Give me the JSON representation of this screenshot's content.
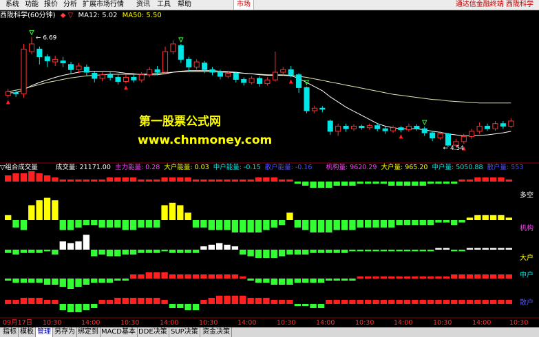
{
  "menu": [
    "系统",
    "功能",
    "报价",
    "分析",
    "扩展市场行情",
    "资讯",
    "工具",
    "帮助"
  ],
  "market_tab": "市场",
  "broker_title": "通达信金融终端  西陇科学",
  "info": {
    "stock": "西陇科学(60分钟)",
    "arrows": "◆ ▽",
    "ma12": "MA12: 5.02",
    "ma50": "MA50: 5.50"
  },
  "price_labels": {
    "high": "6.69",
    "low": "4.54"
  },
  "watermark": {
    "line1": "第一股票公式网",
    "line2": "www.chnmoney.com"
  },
  "sub": {
    "title": "▽组合成交量",
    "vol": "成交量: 21171.00",
    "main": "主力能量: 0.28",
    "big": "大户能量: 0.03",
    "mid": "中户能量: -0.15",
    "small": "散户能量: -0.16",
    "inst": "机构量: 9620.29",
    "bigvol": "大户量: 965.20",
    "midvol": "中户量: 5050.88",
    "smallvol": "散户量: 553"
  },
  "side_labels": [
    "多空",
    "机构",
    "大户",
    "中户",
    "散户"
  ],
  "time_axis": [
    "09月17日",
    "10:30",
    "14:00",
    "10:30",
    "14:00",
    "10:30",
    "14:00",
    "10:30",
    "14:00",
    "10:30",
    "14:00",
    "10:30",
    "14:00",
    "10:30"
  ],
  "tabs": [
    "指标",
    "模板",
    "管理",
    "另存为",
    "绑定到",
    "MACD基本",
    "DDE决策",
    "SUP决策",
    "资金决策"
  ],
  "active_tab": "管理",
  "colors": {
    "up": "#ff3232",
    "down": "#00e6e6",
    "ma12": "#ffffff",
    "ma50": "#e6e6b4",
    "green": "#32ff32",
    "red": "#ff2020",
    "yellow": "#ffff00",
    "white": "#ffffff",
    "gridline": "#8b0000"
  },
  "chart_data": {
    "type": "candlestick",
    "title": "西陇科学(60分钟)",
    "ylim": [
      4.3,
      6.95
    ],
    "candles": [
      {
        "o": 5.55,
        "c": 5.62,
        "h": 5.68,
        "l": 5.5
      },
      {
        "o": 5.6,
        "c": 5.58,
        "h": 5.66,
        "l": 5.52
      },
      {
        "o": 5.58,
        "c": 6.45,
        "h": 6.55,
        "l": 5.5
      },
      {
        "o": 6.4,
        "c": 6.55,
        "h": 6.69,
        "l": 6.35
      },
      {
        "o": 6.45,
        "c": 6.3,
        "h": 6.5,
        "l": 6.15
      },
      {
        "o": 6.3,
        "c": 6.22,
        "h": 6.35,
        "l": 6.1
      },
      {
        "o": 6.2,
        "c": 6.25,
        "h": 6.32,
        "l": 6.12
      },
      {
        "o": 6.22,
        "c": 6.18,
        "h": 6.3,
        "l": 6.1
      },
      {
        "o": 6.15,
        "c": 6.05,
        "h": 6.2,
        "l": 5.98
      },
      {
        "o": 6.05,
        "c": 6.12,
        "h": 6.18,
        "l": 5.98
      },
      {
        "o": 6.1,
        "c": 6.0,
        "h": 6.15,
        "l": 5.92
      },
      {
        "o": 5.98,
        "c": 5.88,
        "h": 6.02,
        "l": 5.8
      },
      {
        "o": 5.88,
        "c": 5.95,
        "h": 6.0,
        "l": 5.82
      },
      {
        "o": 5.95,
        "c": 5.9,
        "h": 6.0,
        "l": 5.84
      },
      {
        "o": 5.9,
        "c": 5.82,
        "h": 5.95,
        "l": 5.76
      },
      {
        "o": 5.82,
        "c": 5.9,
        "h": 5.96,
        "l": 5.78
      },
      {
        "o": 5.9,
        "c": 5.85,
        "h": 5.95,
        "l": 5.8
      },
      {
        "o": 5.85,
        "c": 5.95,
        "h": 6.0,
        "l": 5.8
      },
      {
        "o": 5.95,
        "c": 6.05,
        "h": 6.1,
        "l": 5.9
      },
      {
        "o": 6.05,
        "c": 6.0,
        "h": 6.12,
        "l": 5.95
      },
      {
        "o": 6.0,
        "c": 6.4,
        "h": 6.5,
        "l": 5.98
      },
      {
        "o": 6.4,
        "c": 6.55,
        "h": 6.62,
        "l": 6.35
      },
      {
        "o": 6.52,
        "c": 6.25,
        "h": 6.55,
        "l": 6.18
      },
      {
        "o": 6.25,
        "c": 6.1,
        "h": 6.3,
        "l": 6.02
      },
      {
        "o": 6.1,
        "c": 6.2,
        "h": 6.25,
        "l": 6.05
      },
      {
        "o": 6.18,
        "c": 6.05,
        "h": 6.22,
        "l": 5.98
      },
      {
        "o": 6.05,
        "c": 6.0,
        "h": 6.1,
        "l": 5.94
      },
      {
        "o": 6.0,
        "c": 5.92,
        "h": 6.05,
        "l": 5.86
      },
      {
        "o": 5.92,
        "c": 5.98,
        "h": 6.03,
        "l": 5.88
      },
      {
        "o": 5.98,
        "c": 5.86,
        "h": 6.0,
        "l": 5.8
      },
      {
        "o": 5.86,
        "c": 5.8,
        "h": 5.9,
        "l": 5.74
      },
      {
        "o": 5.8,
        "c": 5.88,
        "h": 5.92,
        "l": 5.76
      },
      {
        "o": 5.88,
        "c": 5.78,
        "h": 5.92,
        "l": 5.72
      },
      {
        "o": 5.78,
        "c": 5.85,
        "h": 5.9,
        "l": 5.74
      },
      {
        "o": 5.85,
        "c": 6.0,
        "h": 6.4,
        "l": 5.82
      },
      {
        "o": 6.0,
        "c": 6.05,
        "h": 6.1,
        "l": 5.94
      },
      {
        "o": 6.05,
        "c": 5.95,
        "h": 6.12,
        "l": 5.9
      },
      {
        "o": 5.95,
        "c": 5.7,
        "h": 5.98,
        "l": 5.6
      },
      {
        "o": 5.7,
        "c": 5.25,
        "h": 5.72,
        "l": 5.2
      },
      {
        "o": 5.25,
        "c": 5.3,
        "h": 5.35,
        "l": 5.2
      },
      {
        "o": 5.3,
        "c": 5.28,
        "h": 5.34,
        "l": 5.22
      },
      {
        "o": 5.05,
        "c": 4.85,
        "h": 5.08,
        "l": 4.78
      },
      {
        "o": 4.85,
        "c": 4.95,
        "h": 5.0,
        "l": 4.76
      },
      {
        "o": 4.95,
        "c": 4.9,
        "h": 5.0,
        "l": 4.84
      },
      {
        "o": 4.9,
        "c": 4.95,
        "h": 4.99,
        "l": 4.86
      },
      {
        "o": 4.95,
        "c": 4.92,
        "h": 4.98,
        "l": 4.88
      },
      {
        "o": 4.92,
        "c": 4.96,
        "h": 5.0,
        "l": 4.88
      },
      {
        "o": 4.96,
        "c": 4.9,
        "h": 5.0,
        "l": 4.85
      },
      {
        "o": 4.9,
        "c": 4.86,
        "h": 4.94,
        "l": 4.8
      },
      {
        "o": 4.86,
        "c": 4.92,
        "h": 4.96,
        "l": 4.82
      },
      {
        "o": 4.92,
        "c": 4.88,
        "h": 4.95,
        "l": 4.83
      },
      {
        "o": 4.88,
        "c": 4.95,
        "h": 5.0,
        "l": 4.84
      },
      {
        "o": 4.95,
        "c": 4.9,
        "h": 4.99,
        "l": 4.86
      },
      {
        "o": 4.9,
        "c": 4.82,
        "h": 4.94,
        "l": 4.76
      },
      {
        "o": 4.82,
        "c": 4.72,
        "h": 4.86,
        "l": 4.66
      },
      {
        "o": 4.72,
        "c": 4.8,
        "h": 4.85,
        "l": 4.68
      },
      {
        "o": 4.8,
        "c": 4.58,
        "h": 4.82,
        "l": 4.54
      },
      {
        "o": 4.58,
        "c": 4.65,
        "h": 4.7,
        "l": 4.54
      },
      {
        "o": 4.65,
        "c": 4.75,
        "h": 4.8,
        "l": 4.6
      },
      {
        "o": 4.75,
        "c": 4.85,
        "h": 4.9,
        "l": 4.7
      },
      {
        "o": 4.85,
        "c": 4.95,
        "h": 5.02,
        "l": 4.8
      },
      {
        "o": 4.95,
        "c": 4.9,
        "h": 5.0,
        "l": 4.86
      },
      {
        "o": 4.9,
        "c": 5.0,
        "h": 5.05,
        "l": 4.86
      },
      {
        "o": 5.0,
        "c": 4.95,
        "h": 5.05,
        "l": 4.9
      },
      {
        "o": 4.95,
        "c": 5.05,
        "h": 5.1,
        "l": 4.92
      }
    ],
    "ma12": [
      5.6,
      5.6,
      5.66,
      5.74,
      5.8,
      5.85,
      5.9,
      5.94,
      5.97,
      6.0,
      6.02,
      6.02,
      6.02,
      6.02,
      6.0,
      5.98,
      5.97,
      5.95,
      5.95,
      5.95,
      5.97,
      6.0,
      6.02,
      6.03,
      6.03,
      6.03,
      6.03,
      6.02,
      6.01,
      6.0,
      5.98,
      5.97,
      5.95,
      5.94,
      5.94,
      5.94,
      5.93,
      5.88,
      5.8,
      5.72,
      5.64,
      5.52,
      5.42,
      5.32,
      5.24,
      5.16,
      5.08,
      5.0,
      4.95,
      4.92,
      4.9,
      4.9,
      4.9,
      4.88,
      4.85,
      4.83,
      4.8,
      4.78,
      4.76,
      4.76,
      4.77,
      4.78,
      4.8,
      4.82,
      4.85
    ],
    "ma50": [
      5.62,
      5.65,
      5.68,
      5.72,
      5.76,
      5.8,
      5.83,
      5.86,
      5.89,
      5.91,
      5.93,
      5.94,
      5.95,
      5.96,
      5.96,
      5.96,
      5.96,
      5.96,
      5.97,
      5.98,
      5.99,
      6.0,
      6.01,
      6.01,
      6.01,
      6.01,
      6.01,
      6.0,
      6.0,
      5.99,
      5.98,
      5.97,
      5.96,
      5.95,
      5.95,
      5.95,
      5.94,
      5.92,
      5.9,
      5.87,
      5.84,
      5.81,
      5.78,
      5.75,
      5.72,
      5.69,
      5.66,
      5.63,
      5.6,
      5.57,
      5.55,
      5.53,
      5.51,
      5.49,
      5.47,
      5.46,
      5.44,
      5.43,
      5.42,
      5.41,
      5.4,
      5.4,
      5.4,
      5.4,
      5.4
    ],
    "markers": [
      {
        "i": 0,
        "kind": "buy"
      },
      {
        "i": 3,
        "kind": "sell"
      },
      {
        "i": 15,
        "kind": "buy"
      },
      {
        "i": 22,
        "kind": "sell"
      },
      {
        "i": 36,
        "kind": "buy"
      },
      {
        "i": 38,
        "kind": "sell"
      },
      {
        "i": 50,
        "kind": "buy"
      },
      {
        "i": 53,
        "kind": "sell"
      },
      {
        "i": 58,
        "kind": "buy"
      }
    ],
    "bands": {
      "duokong": [
        3,
        4,
        4,
        5,
        4,
        3,
        2,
        1,
        1,
        1,
        1,
        1,
        1,
        2,
        2,
        2,
        2,
        1,
        1,
        1,
        2,
        2,
        2,
        2,
        1,
        1,
        1,
        1,
        1,
        1,
        1,
        1,
        2,
        2,
        2,
        1,
        1,
        -1,
        -2,
        -3,
        -3,
        -3,
        -2,
        -2,
        -2,
        -1,
        -1,
        -1,
        -1,
        -2,
        -2,
        -2,
        -2,
        -2,
        -1,
        -1,
        -1,
        -1,
        1,
        1,
        2,
        2,
        2,
        2,
        1
      ],
      "jigou": [
        2,
        -3,
        -4,
        6,
        8,
        9,
        8,
        -4,
        -4,
        -3,
        -2,
        -2,
        -3,
        -3,
        -3,
        -4,
        -4,
        -3,
        -3,
        -3,
        6,
        7,
        6,
        3,
        -3,
        -3,
        -4,
        -4,
        -4,
        -5,
        -5,
        -5,
        -5,
        -4,
        -3,
        -2,
        3,
        -3,
        -4,
        -5,
        -5,
        -5,
        -4,
        -4,
        -4,
        -3,
        -3,
        -3,
        -3,
        -3,
        -2,
        -2,
        -2,
        -2,
        -2,
        -1,
        -1,
        -2,
        -1,
        1,
        2,
        2,
        2,
        2,
        1
      ],
      "dahu": [
        -2,
        -3,
        -2,
        -2,
        -2,
        -1,
        -3,
        5,
        4,
        5,
        9,
        -4,
        -3,
        -4,
        -4,
        -3,
        -3,
        -2,
        -2,
        -2,
        -1,
        -2,
        -2,
        -2,
        -2,
        2,
        3,
        4,
        3,
        2,
        -3,
        -4,
        -5,
        -5,
        -5,
        -4,
        -3,
        -3,
        -3,
        -2,
        -2,
        -2,
        -2,
        -2,
        -1,
        -1,
        -1,
        -1,
        -1,
        -1,
        -1,
        -1,
        -1,
        -1,
        -1,
        1,
        1,
        -1,
        -1,
        1,
        1,
        1,
        1,
        1,
        1
      ],
      "zhonghu": [
        -1,
        -2,
        -2,
        -2,
        -2,
        -3,
        -3,
        -4,
        -5,
        -4,
        -3,
        -2,
        -2,
        -2,
        -1,
        -1,
        2,
        2,
        3,
        3,
        3,
        2,
        2,
        2,
        2,
        2,
        2,
        2,
        2,
        2,
        1,
        -1,
        -2,
        -2,
        -3,
        -3,
        -3,
        -2,
        -2,
        -2,
        -2,
        -1,
        -1,
        -1,
        -1,
        1,
        1,
        1,
        1,
        1,
        1,
        1,
        1,
        1,
        1,
        1,
        1,
        2,
        2,
        2,
        2,
        2,
        2,
        2,
        2
      ],
      "sanhu": [
        2,
        2,
        3,
        3,
        3,
        2,
        2,
        -3,
        -4,
        -4,
        -3,
        -2,
        2,
        2,
        3,
        3,
        3,
        3,
        3,
        3,
        2,
        -2,
        -2,
        -3,
        -3,
        2,
        3,
        4,
        4,
        4,
        4,
        3,
        3,
        3,
        2,
        2,
        2,
        -1,
        -1,
        -2,
        -2,
        2,
        2,
        2,
        2,
        2,
        2,
        2,
        2,
        2,
        2,
        2,
        2,
        2,
        2,
        2,
        2,
        2,
        2,
        2,
        2,
        2,
        2,
        2,
        2
      ]
    }
  }
}
